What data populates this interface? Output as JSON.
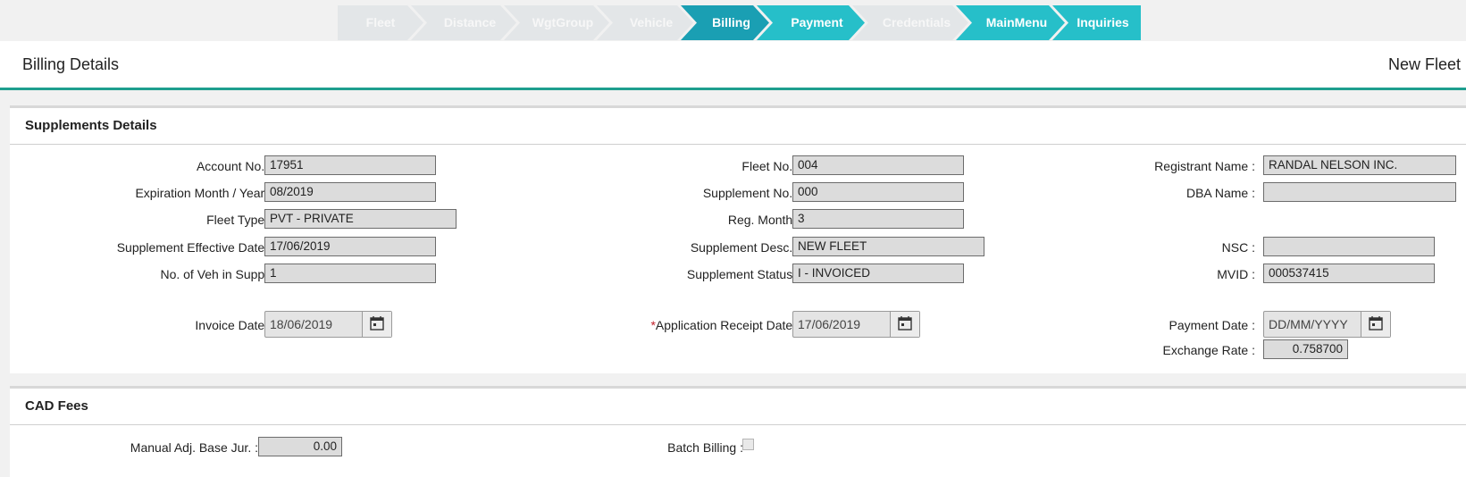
{
  "steps": [
    {
      "label": "Fleet",
      "state": "inactive"
    },
    {
      "label": "Distance",
      "state": "inactive"
    },
    {
      "label": "WgtGroup",
      "state": "inactive"
    },
    {
      "label": "Vehicle",
      "state": "inactive"
    },
    {
      "label": "Billing",
      "state": "active"
    },
    {
      "label": "Payment",
      "state": "enabled"
    },
    {
      "label": "Credentials",
      "state": "inactive"
    },
    {
      "label": "MainMenu",
      "state": "enabled"
    },
    {
      "label": "Inquiries",
      "state": "enabled"
    }
  ],
  "header": {
    "title": "Billing Details",
    "right": "New Fleet"
  },
  "supplements": {
    "title": "Supplements Details",
    "account_no": {
      "label": "Account No. :",
      "value": "17951"
    },
    "expiration": {
      "label": "Expiration Month / Year :",
      "value": "08/2019"
    },
    "fleet_type": {
      "label": "Fleet Type :",
      "value": "PVT - PRIVATE"
    },
    "supp_eff_date": {
      "label": "Supplement Effective Date :",
      "value": "17/06/2019"
    },
    "veh_in_supp": {
      "label": "No. of Veh in Supp :",
      "value": "1"
    },
    "fleet_no": {
      "label": "Fleet No. :",
      "value": "004"
    },
    "supplement_no": {
      "label": "Supplement No. :",
      "value": "000"
    },
    "reg_month": {
      "label": "Reg. Month :",
      "value": "3"
    },
    "supp_desc": {
      "label": "Supplement Desc. :",
      "value": "NEW FLEET"
    },
    "supp_status": {
      "label": "Supplement Status :",
      "value": "I - INVOICED"
    },
    "registrant_name": {
      "label": "Registrant Name :",
      "value": "RANDAL NELSON INC."
    },
    "dba_name": {
      "label": "DBA Name :",
      "value": ""
    },
    "nsc": {
      "label": "NSC :",
      "value": ""
    },
    "mvid": {
      "label": "MVID :",
      "value": "000537415"
    },
    "invoice_date": {
      "label": "Invoice Date :",
      "value": "18/06/2019"
    },
    "app_receipt_date": {
      "required": "*",
      "label": "Application Receipt Date :",
      "value": "17/06/2019"
    },
    "payment_date": {
      "label": "Payment Date :",
      "placeholder": "DD/MM/YYYY"
    },
    "exchange_rate": {
      "label": "Exchange Rate :",
      "value": "0.758700"
    }
  },
  "cad_fees": {
    "title": "CAD Fees",
    "manual_adj": {
      "label": "Manual Adj. Base Jur. :",
      "value": "0.00"
    },
    "batch_billing": {
      "label": "Batch Billing :",
      "checked": false
    }
  },
  "icons": {
    "calendar": "calendar-icon"
  }
}
